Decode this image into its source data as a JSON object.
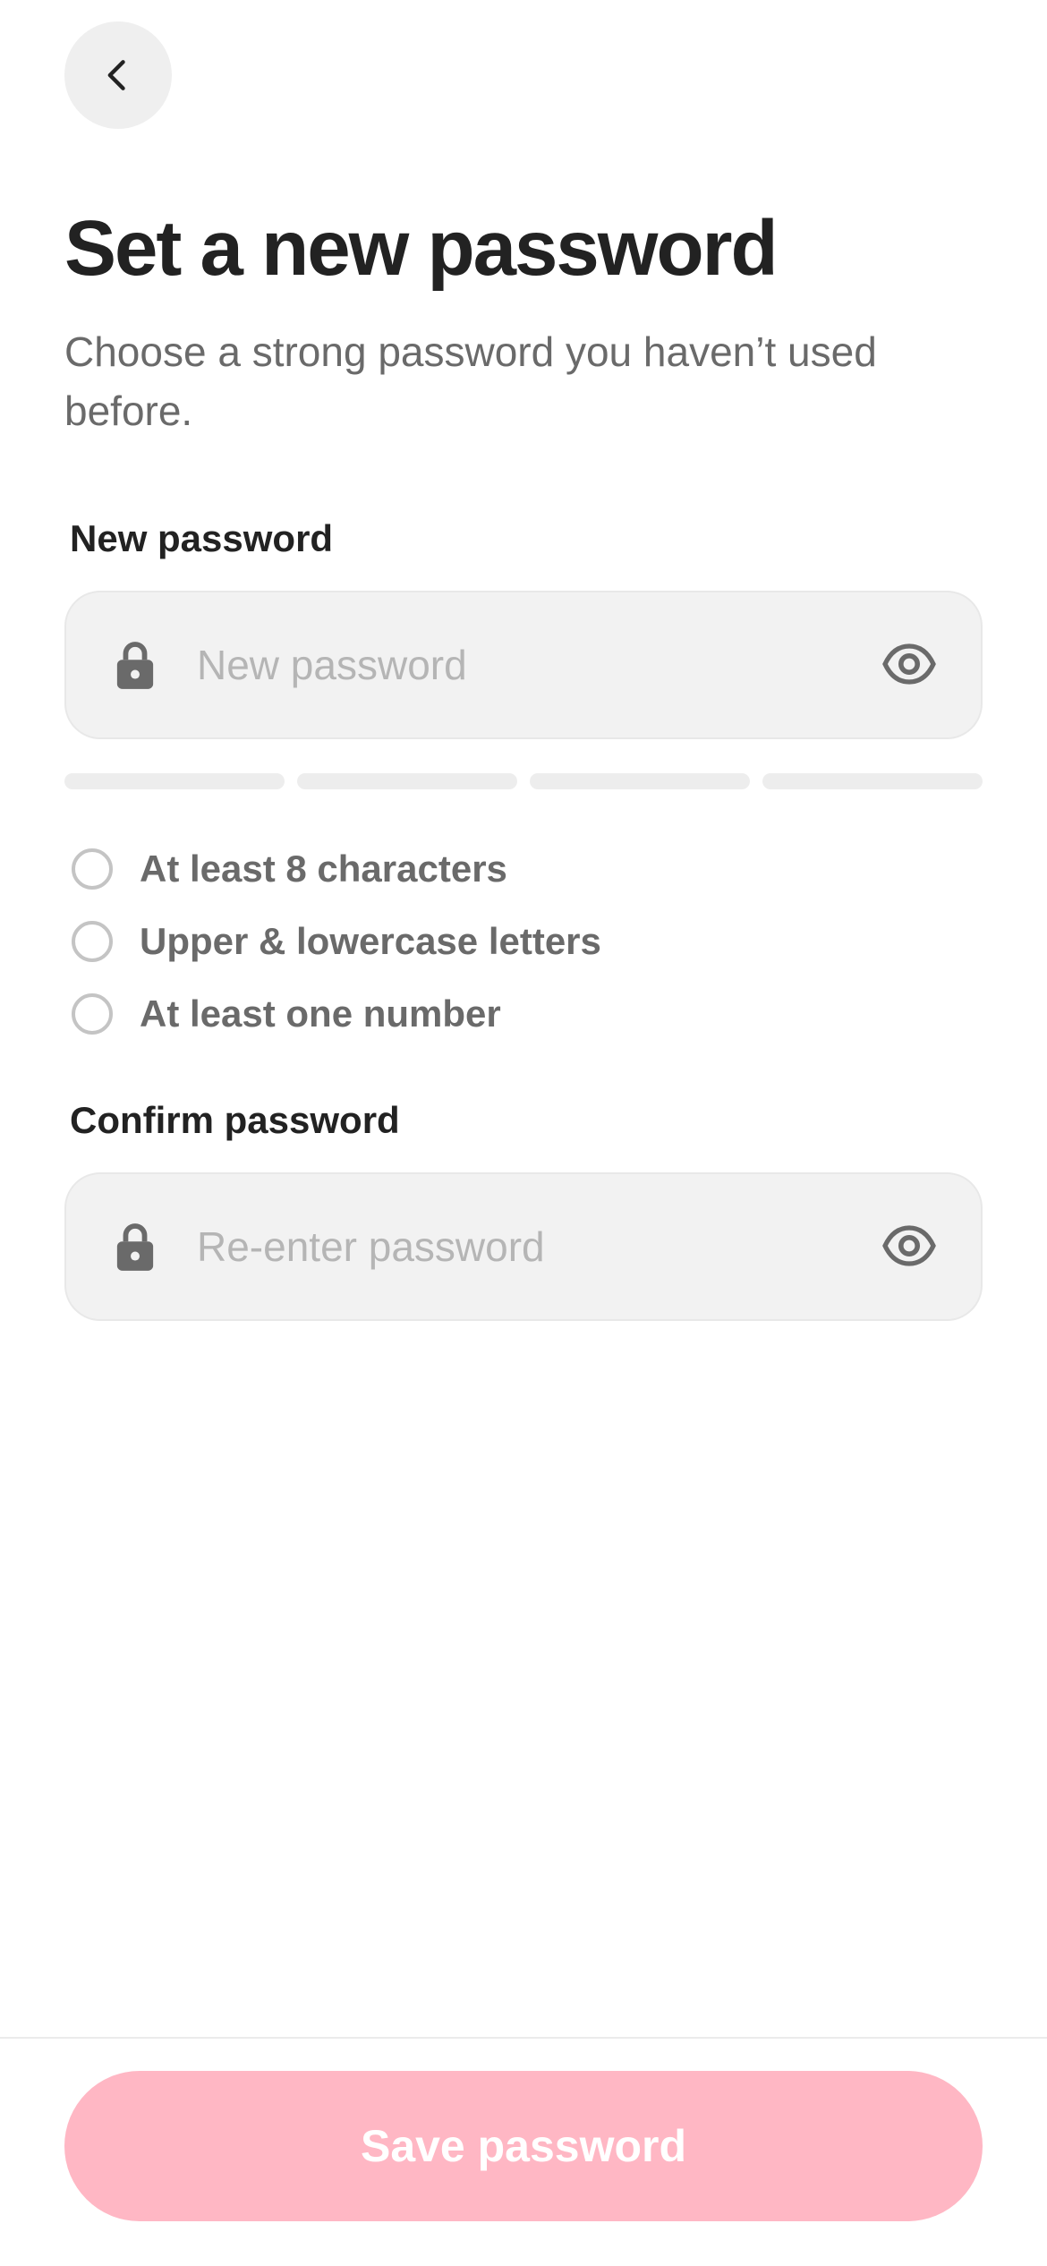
{
  "header": {
    "back_icon": "chevron-left-icon"
  },
  "title": "Set a new password",
  "subtitle": "Choose a strong password you haven’t used before.",
  "new_password": {
    "label": "New password",
    "placeholder": "New password",
    "value": "",
    "lock_icon": "lock-icon",
    "toggle_icon": "eye-icon"
  },
  "strength_meter": {
    "segments": 4,
    "filled": 0,
    "empty_color": "#ededed"
  },
  "requirements": [
    {
      "label": "At least 8 characters",
      "met": false
    },
    {
      "label": "Upper & lowercase letters",
      "met": false
    },
    {
      "label": "At least one number",
      "met": false
    }
  ],
  "confirm_password": {
    "label": "Confirm password",
    "placeholder": "Re-enter password",
    "value": "",
    "lock_icon": "lock-icon",
    "toggle_icon": "eye-icon"
  },
  "save_button": {
    "label": "Save password",
    "enabled": false
  },
  "colors": {
    "accent_disabled": "#ffb7c4",
    "text_primary": "#222222",
    "text_secondary": "#6a6a6a",
    "field_background": "#f2f2f2"
  }
}
